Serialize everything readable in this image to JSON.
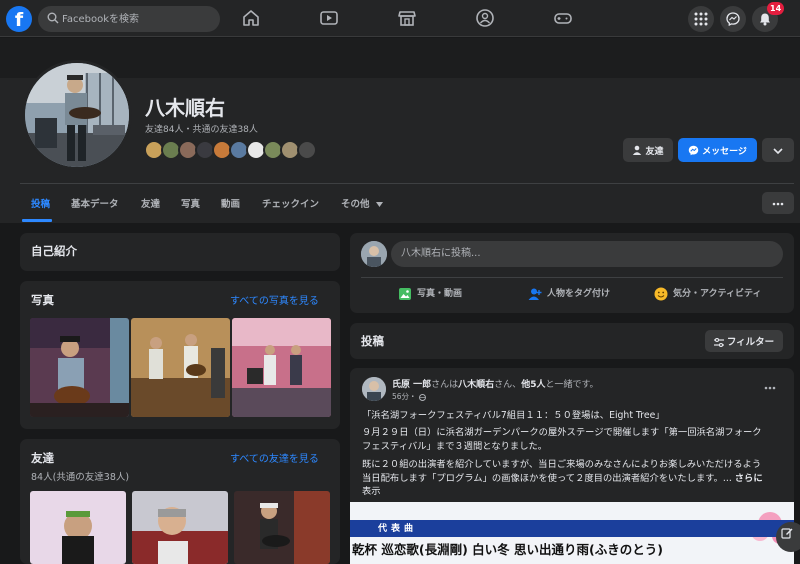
{
  "nav": {
    "logo": "f",
    "search_placeholder": "Facebookを検索",
    "notification_count": "14"
  },
  "profile": {
    "name": "八木順右",
    "friends_summary": "友達84人・共通の友達38人",
    "friend_button": "友達",
    "message_button": "メッセージ"
  },
  "tabs": [
    {
      "label": "投稿"
    },
    {
      "label": "基本データ"
    },
    {
      "label": "友達"
    },
    {
      "label": "写真"
    },
    {
      "label": "動画"
    },
    {
      "label": "チェックイン"
    },
    {
      "label": "その他"
    }
  ],
  "left": {
    "intro_title": "自己紹介",
    "photos_title": "写真",
    "photos_link": "すべての写真を見る",
    "friends_title": "友達",
    "friends_link": "すべての友達を見る",
    "friends_sub": "84人(共通の友達38人)"
  },
  "composer": {
    "placeholder": "八木順右に投稿...",
    "action_photo": "写真・動画",
    "action_tag": "人物をタグ付け",
    "action_feeling": "気分・アクティビティ"
  },
  "posts_section": {
    "title": "投稿",
    "filter": "フィルター"
  },
  "post": {
    "author": "氏原 一郎",
    "with_text_1": "さんは",
    "tagged": "八木順右",
    "with_text_2": "さん、",
    "others": "他5人",
    "with_text_3": "と一緒です。",
    "time": "56分・",
    "line1": "「浜名湖フォークフェスティバル7組目１１：５０登場は、Eight Tree」",
    "line2": "９月２９日（日）に浜名湖ガーデンパークの屋外ステージで開催します「第一回浜名湖フォーク",
    "line3": "フェスティバル」まで３週間となりました。",
    "line4": "既に２０組の出演者を紹介していますが、当日ご来場のみなさんによりお楽しみいただけるよう",
    "line5": "当日配布します「プログラム」の画像ほかを使って２度目の出演者紹介をいたします。...",
    "see_more_1": "さらに",
    "see_more_2": "表示",
    "image_label": "代表曲",
    "image_songs": "乾杯 巡恋歌(長淵剛) 白い冬 思い出通り雨(ふきのとう)"
  },
  "colors": {
    "accent": "#2d88ff",
    "brand": "#1877f2",
    "badge": "#e41e3f"
  }
}
